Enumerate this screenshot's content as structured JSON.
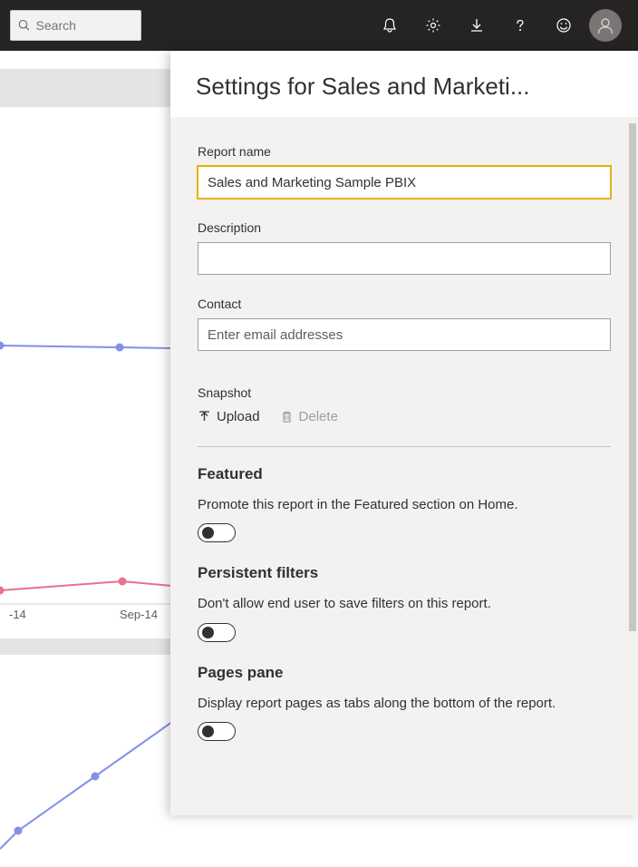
{
  "search": {
    "placeholder": "Search"
  },
  "panel": {
    "title": "Settings for Sales and Marketi...",
    "report_name": {
      "label": "Report name",
      "value": "Sales and Marketing Sample PBIX"
    },
    "description": {
      "label": "Description",
      "value": ""
    },
    "contact": {
      "label": "Contact",
      "placeholder": "Enter email addresses"
    },
    "snapshot": {
      "label": "Snapshot",
      "upload": "Upload",
      "delete": "Delete"
    },
    "featured": {
      "title": "Featured",
      "desc": "Promote this report in the Featured section on Home.",
      "on": false
    },
    "persistent_filters": {
      "title": "Persistent filters",
      "desc": "Don't allow end user to save filters on this report.",
      "on": false
    },
    "pages_pane": {
      "title": "Pages pane",
      "desc": "Display report pages as tabs along the bottom of the report.",
      "on": false
    }
  },
  "background": {
    "axis_labels": [
      "-14",
      "Sep-14"
    ]
  },
  "chart_data": [
    {
      "type": "line",
      "series": [
        {
          "name": "blue",
          "color": "#8290e8",
          "values": [
            325,
            323,
            322
          ]
        }
      ],
      "x": [
        0,
        120,
        190
      ]
    },
    {
      "type": "line",
      "series": [
        {
          "name": "red",
          "color": "#e8718d",
          "values": [
            595,
            585,
            588
          ]
        }
      ],
      "x": [
        0,
        135,
        190
      ],
      "xlabels": [
        "-14",
        "Sep-14"
      ]
    },
    {
      "type": "line",
      "series": [
        {
          "name": "blue",
          "color": "#8290e8",
          "values": [
            880,
            860,
            800,
            740
          ]
        }
      ],
      "x": [
        0,
        20,
        105,
        190
      ]
    }
  ]
}
